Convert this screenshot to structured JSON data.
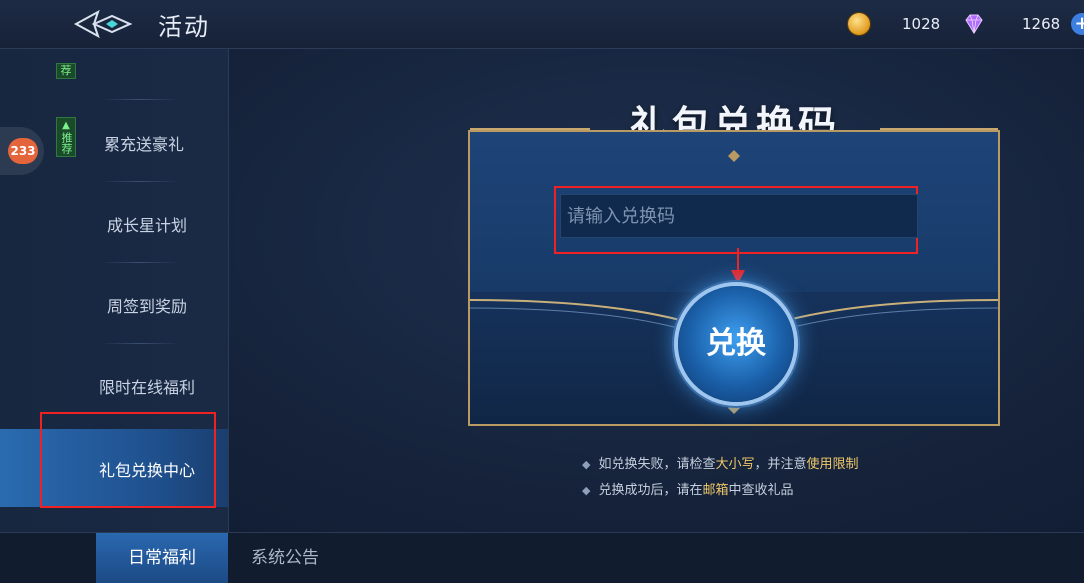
{
  "header": {
    "title": "活动",
    "coins": "1028",
    "gems": "1268",
    "plus": "+"
  },
  "sidebar": {
    "badge": "233",
    "items": [
      {
        "label": "累充送豪礼",
        "tag": "推荐"
      },
      {
        "label": "成长星计划"
      },
      {
        "label": "周签到奖励"
      },
      {
        "label": "限时在线福利"
      },
      {
        "label": "礼包兑换中心",
        "active": true
      }
    ],
    "top_partial_tag": "荐"
  },
  "bottom_tabs": [
    {
      "label": "日常福利",
      "active": true
    },
    {
      "label": "系统公告"
    }
  ],
  "redeem": {
    "title": "礼包兑换码",
    "placeholder": "请输入兑换码",
    "button": "兑换"
  },
  "hints": {
    "line1_a": "如兑换失败，请检查",
    "line1_b": "大小写",
    "line1_c": "，并注意",
    "line1_d": "使用限制",
    "line2_a": "兑换成功后，请在",
    "line2_b": "邮箱",
    "line2_c": "中查收礼品"
  },
  "colors": {
    "accent": "#2a6bb0",
    "highlight": "#f0c868",
    "annotation_red": "#ee2222",
    "gold_frame": "#b89a62"
  }
}
